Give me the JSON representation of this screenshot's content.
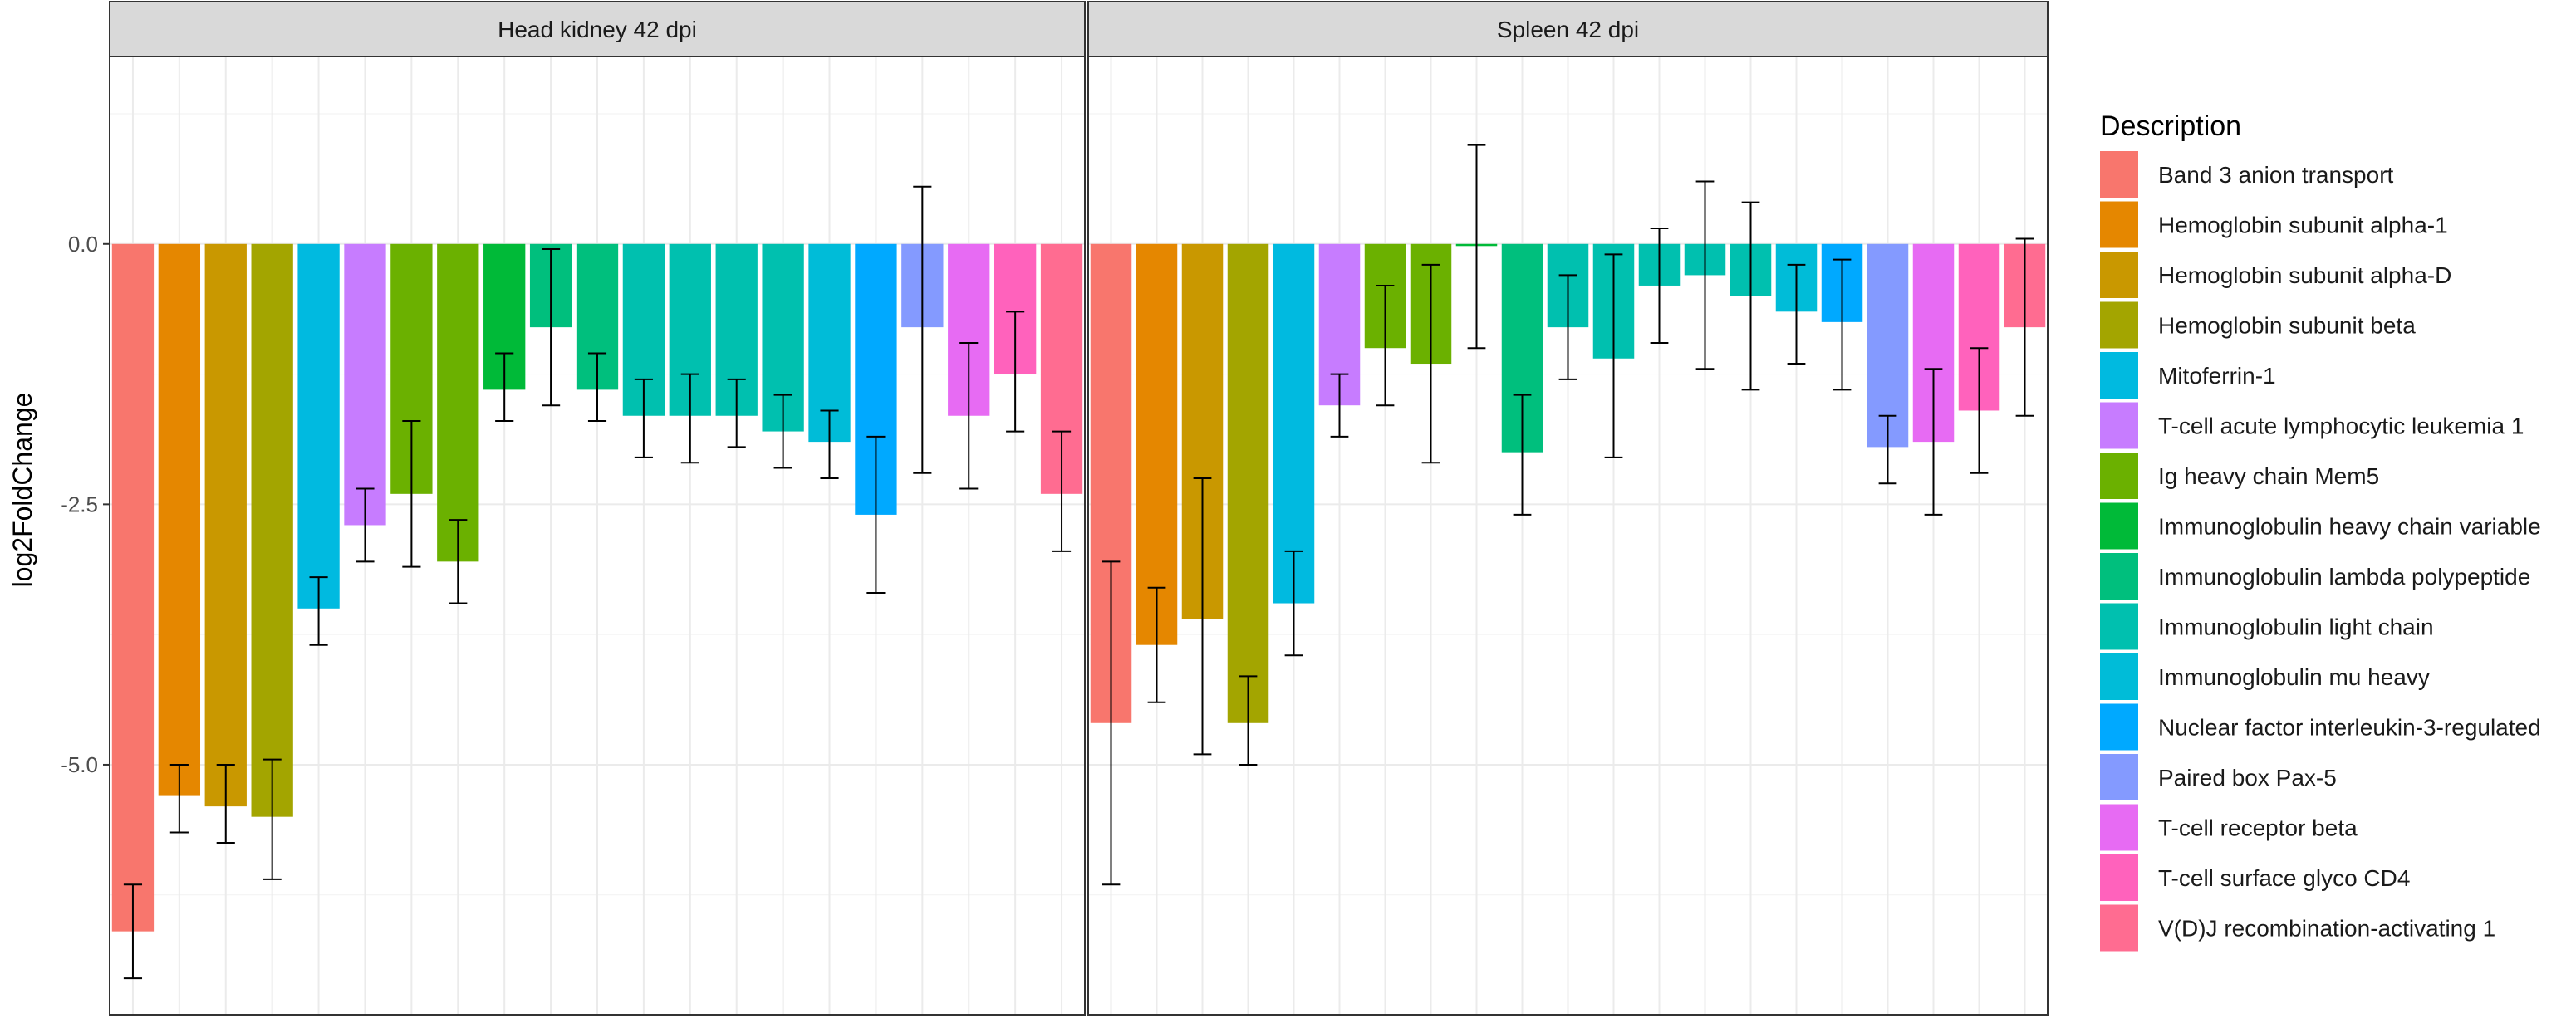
{
  "chart_data": {
    "type": "bar",
    "ylabel": "log2FoldChange",
    "xlabel": "",
    "ylim": [
      -7.4,
      1.8
    ],
    "yticks": [
      0.0,
      -2.5,
      -5.0
    ],
    "ytick_labels": [
      "0.0",
      "-2.5",
      "-5.0"
    ],
    "grid": true,
    "legend_position": "right",
    "legend": {
      "title": "Description",
      "entries": [
        {
          "label": "Band 3 anion transport",
          "color": "#F8766D"
        },
        {
          "label": "Hemoglobin subunit alpha-1",
          "color": "#E58700"
        },
        {
          "label": "Hemoglobin subunit alpha-D",
          "color": "#C99800"
        },
        {
          "label": "Hemoglobin subunit beta",
          "color": "#A3A500"
        },
        {
          "label": "Mitoferrin-1",
          "color": "#00BAE0"
        },
        {
          "label": "T-cell acute lymphocytic leukemia 1",
          "color": "#C77CFF"
        },
        {
          "label": "Ig heavy chain Mem5",
          "color": "#6BB100"
        },
        {
          "label": "Immunoglobulin heavy chain variable",
          "color": "#00BA38"
        },
        {
          "label": "Immunoglobulin lambda polypeptide",
          "color": "#00BF7D"
        },
        {
          "label": "Immunoglobulin light chain",
          "color": "#00C0AF"
        },
        {
          "label": "Immunoglobulin mu heavy",
          "color": "#00BCD8"
        },
        {
          "label": "Nuclear factor interleukin-3-regulated",
          "color": "#00A9FF"
        },
        {
          "label": "Paired box Pax-5",
          "color": "#849AFF"
        },
        {
          "label": "T-cell receptor beta",
          "color": "#E76BF3"
        },
        {
          "label": "T-cell surface glyco CD4",
          "color": "#FF62BC"
        },
        {
          "label": "V(D)J recombination-activating 1",
          "color": "#FF6C91"
        }
      ]
    },
    "panels": [
      {
        "title": "Head kidney 42 dpi",
        "bars": [
          {
            "group": 0,
            "value": -6.6,
            "err_low": -7.05,
            "err_high": -6.15
          },
          {
            "group": 1,
            "value": -5.3,
            "err_low": -5.65,
            "err_high": -5.0
          },
          {
            "group": 2,
            "value": -5.4,
            "err_low": -5.75,
            "err_high": -5.0
          },
          {
            "group": 3,
            "value": -5.5,
            "err_low": -6.1,
            "err_high": -4.95
          },
          {
            "group": 4,
            "value": -3.5,
            "err_low": -3.85,
            "err_high": -3.2
          },
          {
            "group": 5,
            "value": -2.7,
            "err_low": -3.05,
            "err_high": -2.35
          },
          {
            "group": 6,
            "value": -2.4,
            "err_low": -3.1,
            "err_high": -1.7
          },
          {
            "group": 6,
            "value": -3.05,
            "err_low": -3.45,
            "err_high": -2.65
          },
          {
            "group": 7,
            "value": -1.4,
            "err_low": -1.7,
            "err_high": -1.05
          },
          {
            "group": 8,
            "value": -0.8,
            "err_low": -1.55,
            "err_high": -0.05
          },
          {
            "group": 8,
            "value": -1.4,
            "err_low": -1.7,
            "err_high": -1.05
          },
          {
            "group": 9,
            "value": -1.65,
            "err_low": -2.05,
            "err_high": -1.3
          },
          {
            "group": 9,
            "value": -1.65,
            "err_low": -2.1,
            "err_high": -1.25
          },
          {
            "group": 9,
            "value": -1.65,
            "err_low": -1.95,
            "err_high": -1.3
          },
          {
            "group": 9,
            "value": -1.8,
            "err_low": -2.15,
            "err_high": -1.45
          },
          {
            "group": 10,
            "value": -1.9,
            "err_low": -2.25,
            "err_high": -1.6
          },
          {
            "group": 11,
            "value": -2.6,
            "err_low": -3.35,
            "err_high": -1.85
          },
          {
            "group": 12,
            "value": -0.8,
            "err_low": -2.2,
            "err_high": 0.55
          },
          {
            "group": 13,
            "value": -1.65,
            "err_low": -2.35,
            "err_high": -0.95
          },
          {
            "group": 14,
            "value": -1.25,
            "err_low": -1.8,
            "err_high": -0.65
          },
          {
            "group": 15,
            "value": -2.4,
            "err_low": -2.95,
            "err_high": -1.8
          }
        ]
      },
      {
        "title": "Spleen 42 dpi",
        "bars": [
          {
            "group": 0,
            "value": -4.6,
            "err_low": -6.15,
            "err_high": -3.05
          },
          {
            "group": 1,
            "value": -3.85,
            "err_low": -4.4,
            "err_high": -3.3
          },
          {
            "group": 2,
            "value": -3.6,
            "err_low": -4.9,
            "err_high": -2.25
          },
          {
            "group": 3,
            "value": -4.6,
            "err_low": -5.0,
            "err_high": -4.15
          },
          {
            "group": 4,
            "value": -3.45,
            "err_low": -3.95,
            "err_high": -2.95
          },
          {
            "group": 5,
            "value": -1.55,
            "err_low": -1.85,
            "err_high": -1.25
          },
          {
            "group": 6,
            "value": -1.0,
            "err_low": -1.55,
            "err_high": -0.4
          },
          {
            "group": 6,
            "value": -1.15,
            "err_low": -2.1,
            "err_high": -0.2
          },
          {
            "group": 7,
            "value": -0.02,
            "err_low": -1.0,
            "err_high": 0.95
          },
          {
            "group": 8,
            "value": -2.0,
            "err_low": -2.6,
            "err_high": -1.45
          },
          {
            "group": 9,
            "value": -0.8,
            "err_low": -1.3,
            "err_high": -0.3
          },
          {
            "group": 9,
            "value": -1.1,
            "err_low": -2.05,
            "err_high": -0.1
          },
          {
            "group": 9,
            "value": -0.4,
            "err_low": -0.95,
            "err_high": 0.15
          },
          {
            "group": 9,
            "value": -0.3,
            "err_low": -1.2,
            "err_high": 0.6
          },
          {
            "group": 9,
            "value": -0.5,
            "err_low": -1.4,
            "err_high": 0.4
          },
          {
            "group": 10,
            "value": -0.65,
            "err_low": -1.15,
            "err_high": -0.2
          },
          {
            "group": 11,
            "value": -0.75,
            "err_low": -1.4,
            "err_high": -0.15
          },
          {
            "group": 12,
            "value": -1.95,
            "err_low": -2.3,
            "err_high": -1.65
          },
          {
            "group": 13,
            "value": -1.9,
            "err_low": -2.6,
            "err_high": -1.2
          },
          {
            "group": 14,
            "value": -1.6,
            "err_low": -2.2,
            "err_high": -1.0
          },
          {
            "group": 15,
            "value": -0.8,
            "err_low": -1.65,
            "err_high": 0.05
          }
        ]
      }
    ]
  }
}
